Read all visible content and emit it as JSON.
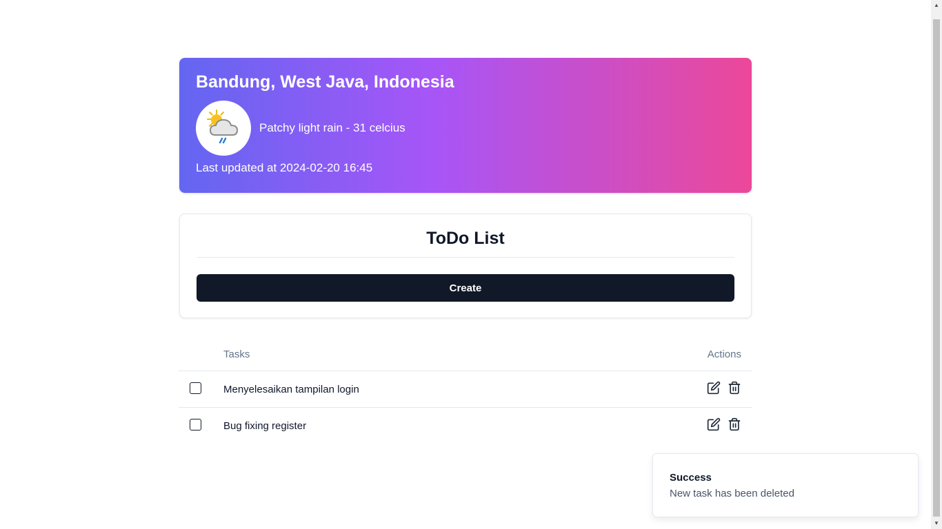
{
  "weather": {
    "location": "Bandung, West Java, Indonesia",
    "description": "Patchy light rain - 31 celcius",
    "last_updated": "Last updated at 2024-02-20 16:45",
    "icon": "patchy-rain-icon"
  },
  "todo": {
    "title": "ToDo List",
    "create_label": "Create"
  },
  "table": {
    "headers": {
      "tasks": "Tasks",
      "actions": "Actions"
    },
    "rows": [
      {
        "task": "Menyelesaikan tampilan login",
        "checked": false
      },
      {
        "task": "Bug fixing register",
        "checked": false
      }
    ]
  },
  "toast": {
    "title": "Success",
    "message": "New task has been deleted"
  },
  "colors": {
    "gradient_start": "#6366f1",
    "gradient_mid": "#a855f7",
    "gradient_end": "#ec4899",
    "button_bg": "#111827"
  }
}
